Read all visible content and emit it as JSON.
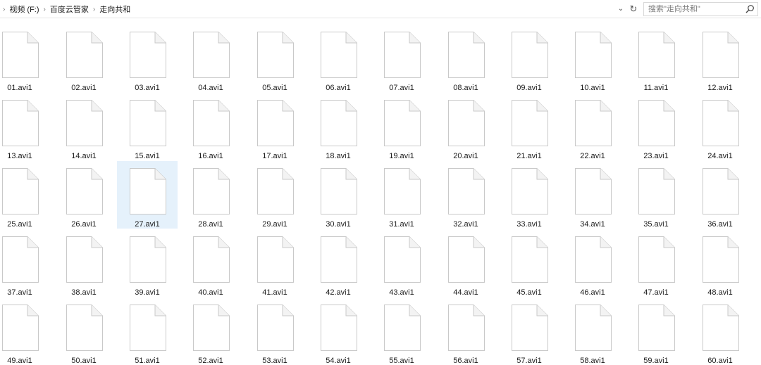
{
  "breadcrumb": [
    "视频 (F:)",
    "百度云管家",
    "走向共和"
  ],
  "search": {
    "placeholder": "搜索\"走向共和\""
  },
  "selected_index": 26,
  "files": [
    "01.avi1",
    "02.avi1",
    "03.avi1",
    "04.avi1",
    "05.avi1",
    "06.avi1",
    "07.avi1",
    "08.avi1",
    "09.avi1",
    "10.avi1",
    "11.avi1",
    "12.avi1",
    "13.avi1",
    "14.avi1",
    "15.avi1",
    "16.avi1",
    "17.avi1",
    "18.avi1",
    "19.avi1",
    "20.avi1",
    "21.avi1",
    "22.avi1",
    "23.avi1",
    "24.avi1",
    "25.avi1",
    "26.avi1",
    "27.avi1",
    "28.avi1",
    "29.avi1",
    "30.avi1",
    "31.avi1",
    "32.avi1",
    "33.avi1",
    "34.avi1",
    "35.avi1",
    "36.avi1",
    "37.avi1",
    "38.avi1",
    "39.avi1",
    "40.avi1",
    "41.avi1",
    "42.avi1",
    "43.avi1",
    "44.avi1",
    "45.avi1",
    "46.avi1",
    "47.avi1",
    "48.avi1",
    "49.avi1",
    "50.avi1",
    "51.avi1",
    "52.avi1",
    "53.avi1",
    "54.avi1",
    "55.avi1",
    "56.avi1",
    "57.avi1",
    "58.avi1",
    "59.avi1",
    "60.avi1"
  ],
  "icons": {
    "file": "generic-file-icon",
    "search": "search-icon",
    "refresh": "refresh-icon",
    "dropdown": "chevron-down-icon"
  },
  "colors": {
    "selection": "#e5f1fb"
  }
}
